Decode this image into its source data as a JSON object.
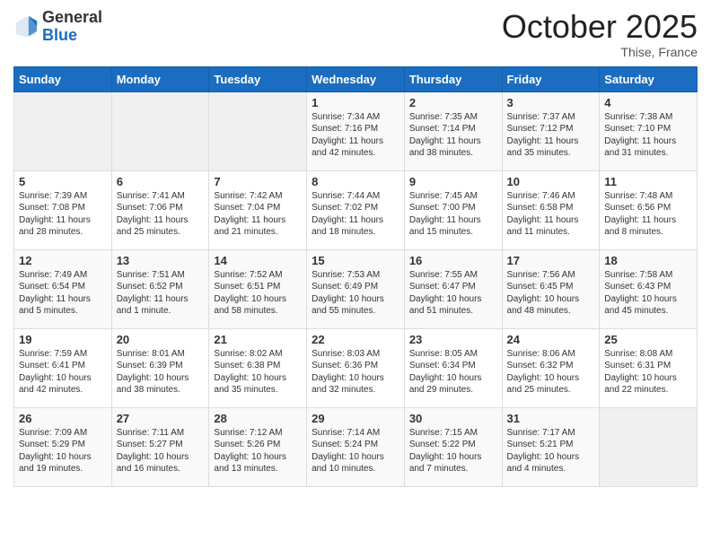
{
  "header": {
    "logo_general": "General",
    "logo_blue": "Blue",
    "month_title": "October 2025",
    "location": "Thise, France"
  },
  "days_of_week": [
    "Sunday",
    "Monday",
    "Tuesday",
    "Wednesday",
    "Thursday",
    "Friday",
    "Saturday"
  ],
  "weeks": [
    [
      {
        "day": "",
        "sunrise": "",
        "sunset": "",
        "daylight": ""
      },
      {
        "day": "",
        "sunrise": "",
        "sunset": "",
        "daylight": ""
      },
      {
        "day": "",
        "sunrise": "",
        "sunset": "",
        "daylight": ""
      },
      {
        "day": "1",
        "sunrise": "Sunrise: 7:34 AM",
        "sunset": "Sunset: 7:16 PM",
        "daylight": "Daylight: 11 hours and 42 minutes."
      },
      {
        "day": "2",
        "sunrise": "Sunrise: 7:35 AM",
        "sunset": "Sunset: 7:14 PM",
        "daylight": "Daylight: 11 hours and 38 minutes."
      },
      {
        "day": "3",
        "sunrise": "Sunrise: 7:37 AM",
        "sunset": "Sunset: 7:12 PM",
        "daylight": "Daylight: 11 hours and 35 minutes."
      },
      {
        "day": "4",
        "sunrise": "Sunrise: 7:38 AM",
        "sunset": "Sunset: 7:10 PM",
        "daylight": "Daylight: 11 hours and 31 minutes."
      }
    ],
    [
      {
        "day": "5",
        "sunrise": "Sunrise: 7:39 AM",
        "sunset": "Sunset: 7:08 PM",
        "daylight": "Daylight: 11 hours and 28 minutes."
      },
      {
        "day": "6",
        "sunrise": "Sunrise: 7:41 AM",
        "sunset": "Sunset: 7:06 PM",
        "daylight": "Daylight: 11 hours and 25 minutes."
      },
      {
        "day": "7",
        "sunrise": "Sunrise: 7:42 AM",
        "sunset": "Sunset: 7:04 PM",
        "daylight": "Daylight: 11 hours and 21 minutes."
      },
      {
        "day": "8",
        "sunrise": "Sunrise: 7:44 AM",
        "sunset": "Sunset: 7:02 PM",
        "daylight": "Daylight: 11 hours and 18 minutes."
      },
      {
        "day": "9",
        "sunrise": "Sunrise: 7:45 AM",
        "sunset": "Sunset: 7:00 PM",
        "daylight": "Daylight: 11 hours and 15 minutes."
      },
      {
        "day": "10",
        "sunrise": "Sunrise: 7:46 AM",
        "sunset": "Sunset: 6:58 PM",
        "daylight": "Daylight: 11 hours and 11 minutes."
      },
      {
        "day": "11",
        "sunrise": "Sunrise: 7:48 AM",
        "sunset": "Sunset: 6:56 PM",
        "daylight": "Daylight: 11 hours and 8 minutes."
      }
    ],
    [
      {
        "day": "12",
        "sunrise": "Sunrise: 7:49 AM",
        "sunset": "Sunset: 6:54 PM",
        "daylight": "Daylight: 11 hours and 5 minutes."
      },
      {
        "day": "13",
        "sunrise": "Sunrise: 7:51 AM",
        "sunset": "Sunset: 6:52 PM",
        "daylight": "Daylight: 11 hours and 1 minute."
      },
      {
        "day": "14",
        "sunrise": "Sunrise: 7:52 AM",
        "sunset": "Sunset: 6:51 PM",
        "daylight": "Daylight: 10 hours and 58 minutes."
      },
      {
        "day": "15",
        "sunrise": "Sunrise: 7:53 AM",
        "sunset": "Sunset: 6:49 PM",
        "daylight": "Daylight: 10 hours and 55 minutes."
      },
      {
        "day": "16",
        "sunrise": "Sunrise: 7:55 AM",
        "sunset": "Sunset: 6:47 PM",
        "daylight": "Daylight: 10 hours and 51 minutes."
      },
      {
        "day": "17",
        "sunrise": "Sunrise: 7:56 AM",
        "sunset": "Sunset: 6:45 PM",
        "daylight": "Daylight: 10 hours and 48 minutes."
      },
      {
        "day": "18",
        "sunrise": "Sunrise: 7:58 AM",
        "sunset": "Sunset: 6:43 PM",
        "daylight": "Daylight: 10 hours and 45 minutes."
      }
    ],
    [
      {
        "day": "19",
        "sunrise": "Sunrise: 7:59 AM",
        "sunset": "Sunset: 6:41 PM",
        "daylight": "Daylight: 10 hours and 42 minutes."
      },
      {
        "day": "20",
        "sunrise": "Sunrise: 8:01 AM",
        "sunset": "Sunset: 6:39 PM",
        "daylight": "Daylight: 10 hours and 38 minutes."
      },
      {
        "day": "21",
        "sunrise": "Sunrise: 8:02 AM",
        "sunset": "Sunset: 6:38 PM",
        "daylight": "Daylight: 10 hours and 35 minutes."
      },
      {
        "day": "22",
        "sunrise": "Sunrise: 8:03 AM",
        "sunset": "Sunset: 6:36 PM",
        "daylight": "Daylight: 10 hours and 32 minutes."
      },
      {
        "day": "23",
        "sunrise": "Sunrise: 8:05 AM",
        "sunset": "Sunset: 6:34 PM",
        "daylight": "Daylight: 10 hours and 29 minutes."
      },
      {
        "day": "24",
        "sunrise": "Sunrise: 8:06 AM",
        "sunset": "Sunset: 6:32 PM",
        "daylight": "Daylight: 10 hours and 25 minutes."
      },
      {
        "day": "25",
        "sunrise": "Sunrise: 8:08 AM",
        "sunset": "Sunset: 6:31 PM",
        "daylight": "Daylight: 10 hours and 22 minutes."
      }
    ],
    [
      {
        "day": "26",
        "sunrise": "Sunrise: 7:09 AM",
        "sunset": "Sunset: 5:29 PM",
        "daylight": "Daylight: 10 hours and 19 minutes."
      },
      {
        "day": "27",
        "sunrise": "Sunrise: 7:11 AM",
        "sunset": "Sunset: 5:27 PM",
        "daylight": "Daylight: 10 hours and 16 minutes."
      },
      {
        "day": "28",
        "sunrise": "Sunrise: 7:12 AM",
        "sunset": "Sunset: 5:26 PM",
        "daylight": "Daylight: 10 hours and 13 minutes."
      },
      {
        "day": "29",
        "sunrise": "Sunrise: 7:14 AM",
        "sunset": "Sunset: 5:24 PM",
        "daylight": "Daylight: 10 hours and 10 minutes."
      },
      {
        "day": "30",
        "sunrise": "Sunrise: 7:15 AM",
        "sunset": "Sunset: 5:22 PM",
        "daylight": "Daylight: 10 hours and 7 minutes."
      },
      {
        "day": "31",
        "sunrise": "Sunrise: 7:17 AM",
        "sunset": "Sunset: 5:21 PM",
        "daylight": "Daylight: 10 hours and 4 minutes."
      },
      {
        "day": "",
        "sunrise": "",
        "sunset": "",
        "daylight": ""
      }
    ]
  ]
}
